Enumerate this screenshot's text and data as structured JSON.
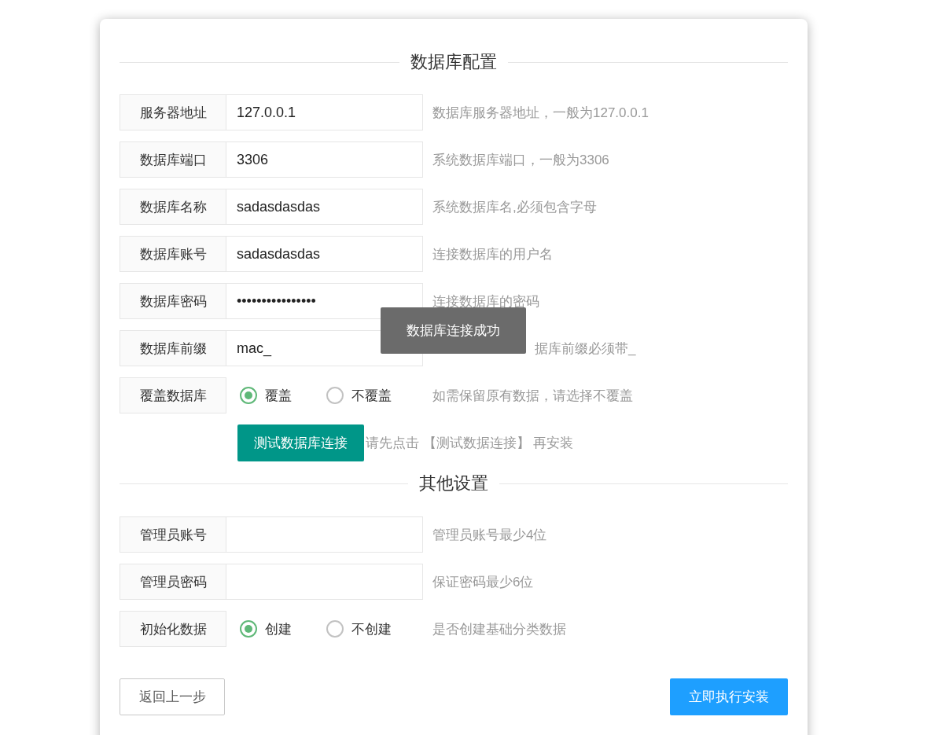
{
  "sections": [
    {
      "title": "数据库配置",
      "fields": [
        {
          "kind": "text",
          "label": "服务器地址",
          "value": "127.0.0.1",
          "hint": "数据库服务器地址，一般为127.0.0.1"
        },
        {
          "kind": "text",
          "label": "数据库端口",
          "value": "3306",
          "hint": "系统数据库端口，一般为3306"
        },
        {
          "kind": "text",
          "label": "数据库名称",
          "value": "sadasdasdas",
          "hint": "系统数据库名,必须包含字母"
        },
        {
          "kind": "text",
          "label": "数据库账号",
          "value": "sadasdasdas",
          "hint": "连接数据库的用户名"
        },
        {
          "kind": "text",
          "label": "数据库密码",
          "value": "••••••••••••••••",
          "hint": "连接数据库的密码"
        },
        {
          "kind": "text",
          "label": "数据库前缀",
          "value": "mac_",
          "hint": "据库前缀必须带_",
          "toast": "数据库连接成功"
        },
        {
          "kind": "radio",
          "label": "覆盖数据库",
          "options": [
            {
              "label": "覆盖",
              "selected": true
            },
            {
              "label": "不覆盖",
              "selected": false
            }
          ],
          "hint": "如需保留原有数据，请选择不覆盖"
        }
      ],
      "action": {
        "button": "测试数据库连接",
        "note": "请先点击 【测试数据连接】 再安装"
      }
    },
    {
      "title": "其他设置",
      "fields": [
        {
          "kind": "text",
          "label": "管理员账号",
          "hint": "管理员账号最少4位"
        },
        {
          "kind": "text",
          "label": "管理员密码",
          "hint": "保证密码最少6位"
        },
        {
          "kind": "radio",
          "label": "初始化数据",
          "options": [
            {
              "label": "创建",
              "selected": true
            },
            {
              "label": "不创建",
              "selected": false
            }
          ],
          "hint": "是否创建基础分类数据"
        }
      ]
    }
  ],
  "buttons": {
    "back": "返回上一步",
    "install": "立即执行安装"
  }
}
